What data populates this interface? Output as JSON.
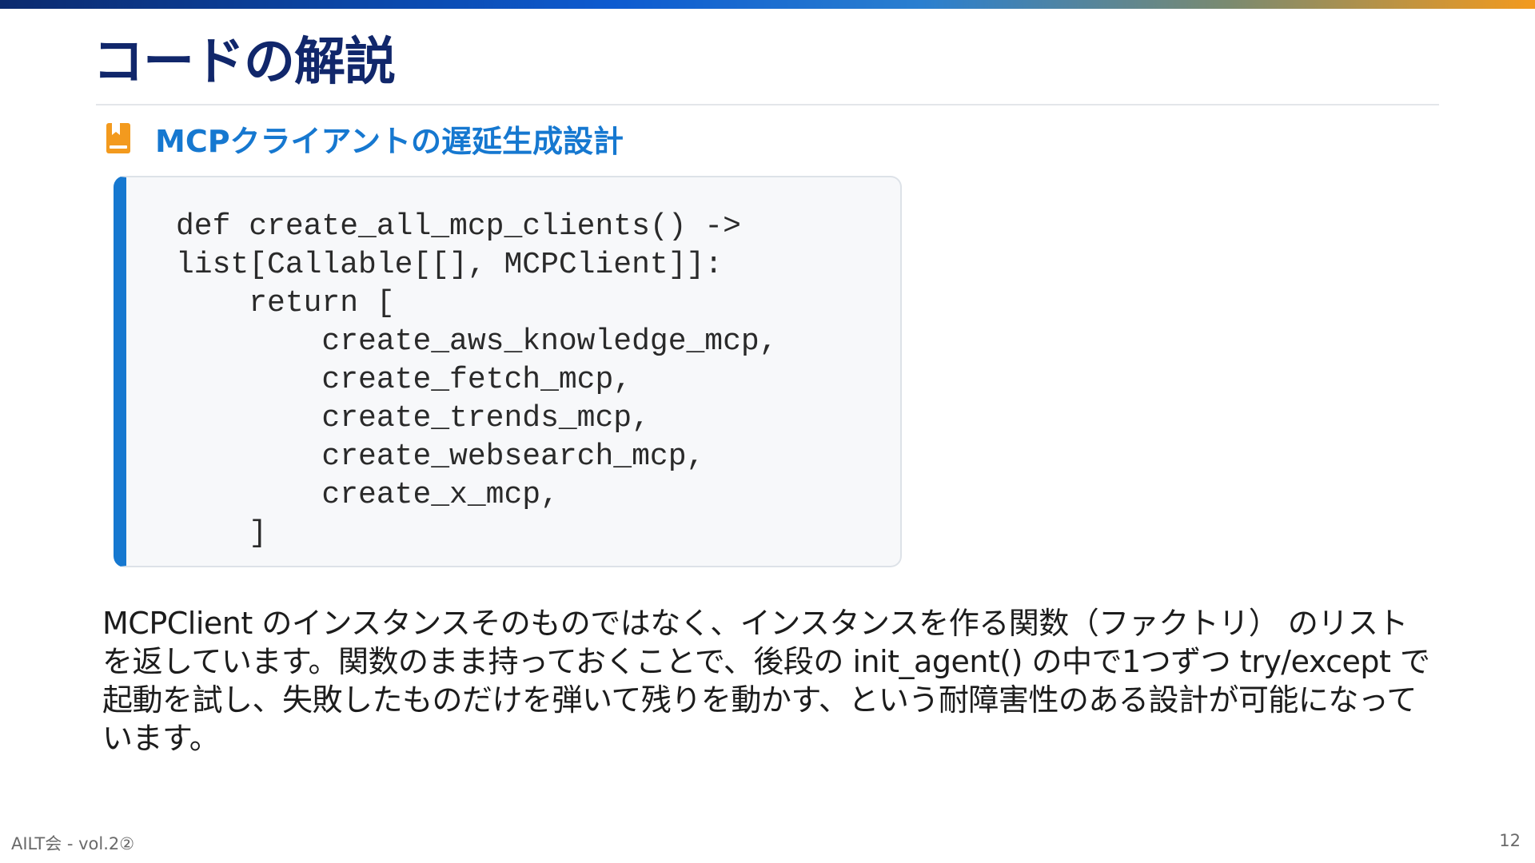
{
  "slide": {
    "title": "コードの解説",
    "section": {
      "icon": "bookmark-book-icon",
      "title": "MCPクライアントの遅延生成設計"
    },
    "code": "def create_all_mcp_clients() ->\nlist[Callable[[], MCPClient]]:\n    return [\n        create_aws_knowledge_mcp,\n        create_fetch_mcp,\n        create_trends_mcp,\n        create_websearch_mcp,\n        create_x_mcp,\n    ]",
    "description": "MCPClient のインスタンスそのものではなく、インスタンスを作る関数（ファクトリ） のリストを返しています。関数のまま持っておくことで、後段の init_agent() の中で1つずつ try/except で起動を試し、失敗したものだけを弾いて残りを動かす、という耐障害性のある設計が可能になっています。",
    "footer": {
      "event": "AILT会 - vol.2②",
      "page_number": "12"
    }
  },
  "colors": {
    "title": "#11276b",
    "accent_blue": "#1678d0",
    "accent_orange": "#f39a1e",
    "code_bg": "#f7f8fa"
  }
}
